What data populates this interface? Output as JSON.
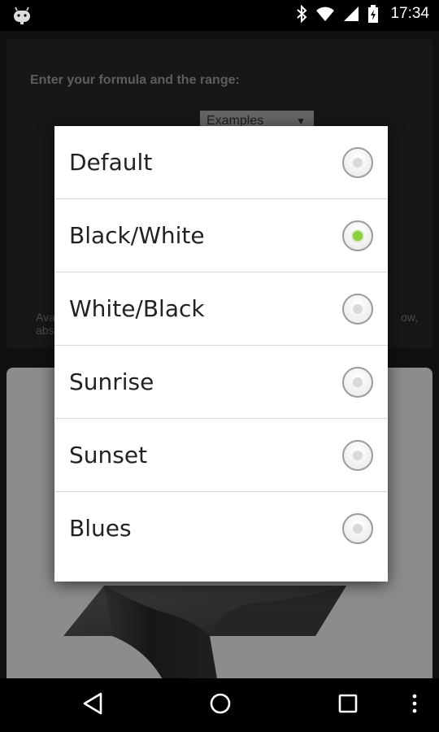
{
  "status_bar": {
    "time": "17:34"
  },
  "app": {
    "formula_heading": "Enter your formula and the range:",
    "examples_dropdown": "Examples",
    "available_text_left": "Ava",
    "available_text_right": "ow,",
    "available_text_second_line": "abs"
  },
  "dialog": {
    "options": [
      {
        "label": "Default",
        "checked": false
      },
      {
        "label": "Black/White",
        "checked": true
      },
      {
        "label": "White/Black",
        "checked": false
      },
      {
        "label": "Sunrise",
        "checked": false
      },
      {
        "label": "Sunset",
        "checked": false
      },
      {
        "label": "Blues",
        "checked": false
      }
    ]
  },
  "colors": {
    "radio_selected": "#8bd23a",
    "dialog_background": "#ffffff",
    "app_background": "#1e1e1e"
  },
  "icons": [
    "android-icon",
    "bluetooth-icon",
    "wifi-icon",
    "signal-icon",
    "battery-icon",
    "back-icon",
    "home-icon",
    "recents-icon",
    "overflow-menu-icon"
  ]
}
